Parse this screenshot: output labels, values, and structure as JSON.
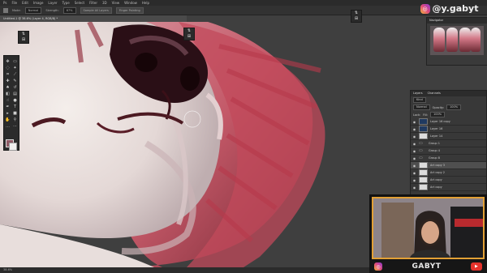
{
  "menu": [
    "Ps",
    "File",
    "Edit",
    "Image",
    "Layer",
    "Type",
    "Select",
    "Filter",
    "3D",
    "View",
    "Window",
    "Help"
  ],
  "options": {
    "mode_label": "Mode:",
    "mode_value": "Normal",
    "strength_label": "Strength:",
    "strength_value": "67%",
    "sample_all": "Sample All Layers",
    "finger": "Finger Painting"
  },
  "document_tab": "Untitled-1 @ 38.6% (Layer 4, RGB/8) *",
  "status": "38.6%",
  "watermark": {
    "handle": "@y.gabyt"
  },
  "navigator": {
    "tabs": [
      "Navigator"
    ]
  },
  "layers_panel": {
    "tabs": [
      "Layers",
      "Channels"
    ],
    "kind": "Kind",
    "blend": "Normal",
    "opacity_label": "Opacity:",
    "opacity_value": "100%",
    "lock_label": "Lock:",
    "fill_label": "Fill:",
    "fill_value": "100%",
    "rows": [
      {
        "name": "Layer 16 copy",
        "type": "dark"
      },
      {
        "name": "Layer 16",
        "type": "dark"
      },
      {
        "name": "Layer 14",
        "type": "plain"
      },
      {
        "name": "Group 1",
        "type": "folder"
      },
      {
        "name": "Group 4",
        "type": "folder"
      },
      {
        "name": "Group 8",
        "type": "folder"
      },
      {
        "name": "Art copy 3",
        "type": "plain"
      },
      {
        "name": "Art copy 2",
        "type": "plain"
      },
      {
        "name": "Art copy",
        "type": "plain"
      },
      {
        "name": "Art copy",
        "type": "plain"
      }
    ]
  },
  "webcam": {
    "brand": "GABYT"
  },
  "icons": {
    "ig": "instagram-icon",
    "yt": "youtube-icon"
  }
}
